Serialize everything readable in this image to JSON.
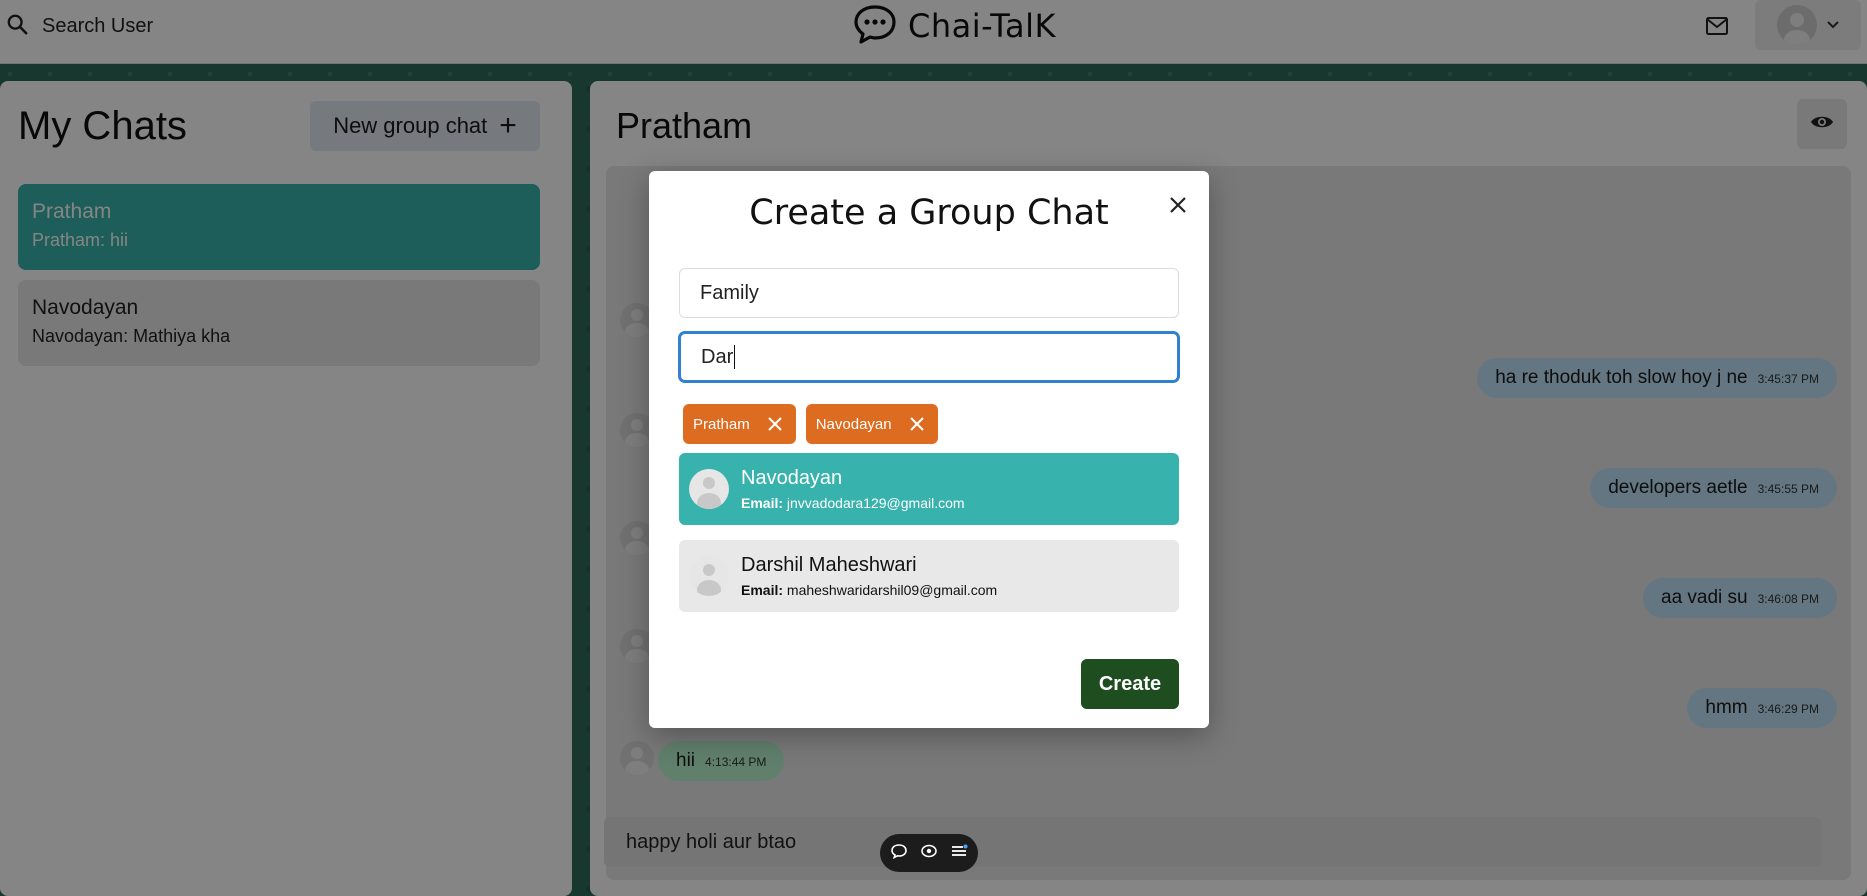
{
  "header": {
    "search_label": "Search User",
    "brand_title": "Chai-TalK"
  },
  "sidebar": {
    "title": "My Chats",
    "new_group_label": "New group chat",
    "new_group_icon": "+",
    "chats": [
      {
        "name": "Pratham",
        "last_message": "Pratham: hii",
        "active": true
      },
      {
        "name": "Navodayan",
        "last_message": "Navodayan: Mathiya kha",
        "active": false
      }
    ]
  },
  "chat": {
    "title": "Pratham",
    "messages": [
      {
        "text": "ha re thoduk toh slow hoy j ne",
        "time": "3:45:37 PM",
        "direction": "out"
      },
      {
        "text": "developers aetle",
        "time": "3:45:55 PM",
        "direction": "out"
      },
      {
        "text": "aa vadi su",
        "time": "3:46:08 PM",
        "direction": "out"
      },
      {
        "text": "hmm",
        "time": "3:46:29 PM",
        "direction": "out"
      },
      {
        "text": "hii",
        "time": "4:13:44 PM",
        "direction": "in"
      }
    ],
    "input_value": "happy holi aur btao"
  },
  "modal": {
    "title": "Create a Group Chat",
    "chat_name_value": "Family",
    "search_value": "Dar",
    "selected_users": [
      "Pratham",
      "Navodayan"
    ],
    "email_label": "Email:",
    "results": [
      {
        "name": "Navodayan",
        "email": "jnvvadodara129@gmail.com",
        "highlighted": true
      },
      {
        "name": "Darshil Maheshwari",
        "email": "maheshwaridarshil09@gmail.com",
        "highlighted": false
      }
    ],
    "create_label": "Create"
  },
  "colors": {
    "accent_teal": "#38b2ac",
    "tag_orange": "#dd6b20",
    "create_green": "#1e4d1f",
    "bubble_out": "#bee3f8",
    "bubble_in": "#b9f5d0"
  },
  "icons": [
    "search-icon",
    "chat-bubble-logo-icon",
    "mail-icon",
    "avatar-icon",
    "chevron-down-icon",
    "plus-icon",
    "eye-icon",
    "close-icon",
    "message-icon",
    "view-icon",
    "menu-icon"
  ]
}
